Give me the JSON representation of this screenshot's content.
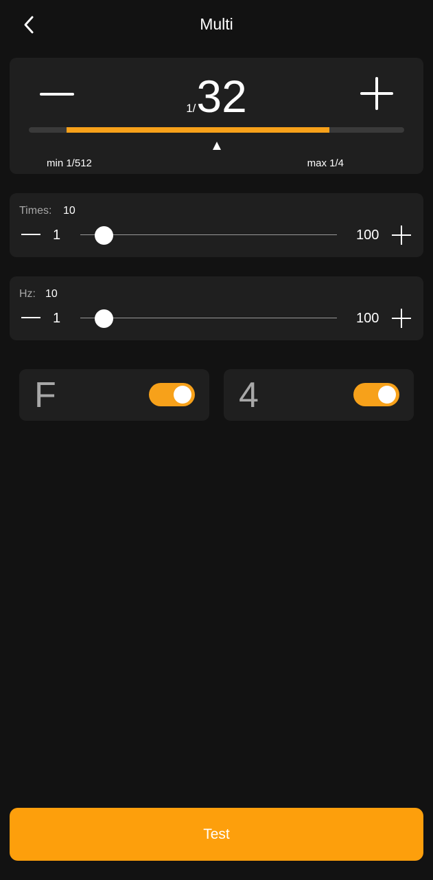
{
  "header": {
    "title": "Multi",
    "back_icon": "chevron-left-icon"
  },
  "power": {
    "prefix": "1/",
    "denominator": "32",
    "min_label": "min 1/512",
    "max_label": "max 1/4",
    "minus_icon": "minus-icon",
    "plus_icon": "plus-icon",
    "range_start_fraction": 0.1,
    "range_end_fraction": 0.8,
    "pointer_fraction": 0.5
  },
  "times": {
    "label": "Times:",
    "current": "10",
    "min": "1",
    "max": "100",
    "value": 10
  },
  "hz": {
    "label": "Hz:",
    "current": "10",
    "min": "1",
    "max": "100",
    "value": 10
  },
  "toggles": [
    {
      "label": "F",
      "on": true
    },
    {
      "label": "4",
      "on": true
    }
  ],
  "test_button": {
    "label": "Test"
  },
  "colors": {
    "accent": "#f7a11a",
    "background": "#121212",
    "card": "#1f1f1f",
    "button": "#fd9f0c"
  }
}
